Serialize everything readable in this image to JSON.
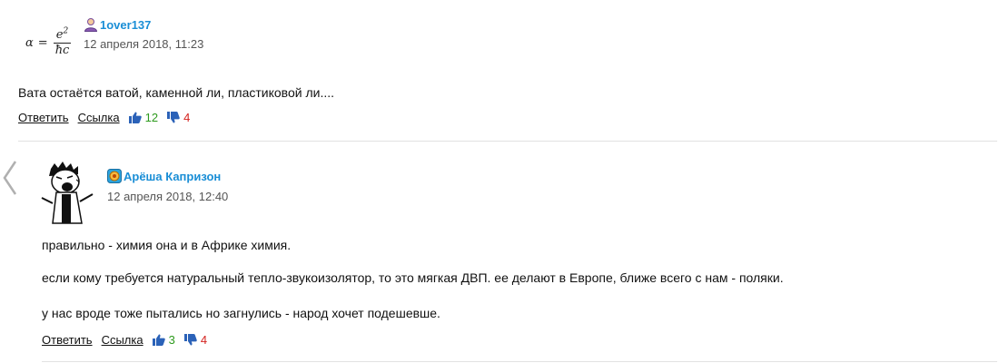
{
  "comment1": {
    "avatar_formula": {
      "lhs": "α",
      "eq": "=",
      "num": "e",
      "num_sup": "2",
      "den": "ħc"
    },
    "username": "1over137",
    "user_icon": "person-icon",
    "date": "12 апреля 2018, 11:23",
    "text": "Вата остаётся ватой, каменной ли, пластиковой ли....",
    "reply_label": "Ответить",
    "link_label": "Ссылка",
    "likes": "12",
    "dislikes": "4"
  },
  "comment2": {
    "avatar_icon": "crying-boy-avatar",
    "username": "Арёша Капризон",
    "user_icon": "badge-icon",
    "date": "12 апреля 2018, 12:40",
    "paragraphs": [
      "правильно - химия она и в Африке химия.",
      "если кому требуется натуральный тепло-звукоизолятор, то это мягкая ДВП. ее делают в Европе, ближе всего с нам - поляки.",
      "у нас вроде тоже пытались но загнулись - народ хочет подешевше."
    ],
    "reply_label": "Ответить",
    "link_label": "Ссылка",
    "likes": "3",
    "dislikes": "4"
  },
  "colors": {
    "username": "#1a8ed6",
    "likes": "#2e9b1e",
    "dislikes": "#d4231f",
    "thumb": "#2b62b8"
  }
}
